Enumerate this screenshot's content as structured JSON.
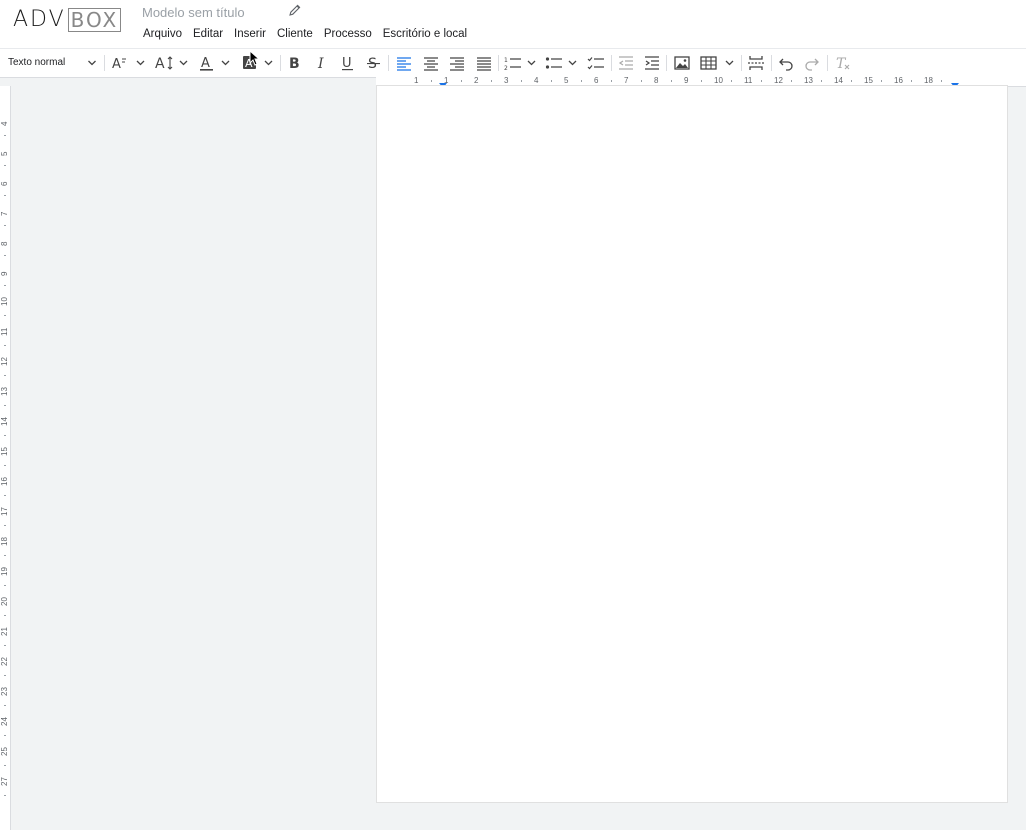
{
  "header": {
    "logo_part1": "ADV",
    "logo_part2": "BOX",
    "title_placeholder": "Modelo sem título",
    "edit_icon": "pencil-icon"
  },
  "menu": [
    {
      "label": "Arquivo"
    },
    {
      "label": "Editar"
    },
    {
      "label": "Inserir"
    },
    {
      "label": "Cliente"
    },
    {
      "label": "Processo"
    },
    {
      "label": "Escritório e local"
    }
  ],
  "toolbar": {
    "paragraph_style": "Texto normal",
    "icons": [
      "font-size-icon",
      "line-height-icon",
      "text-color-icon",
      "highlight-color-icon",
      "bold-icon",
      "italic-icon",
      "underline-icon",
      "strikethrough-icon",
      "align-left-icon",
      "align-center-icon",
      "align-right-icon",
      "align-justify-icon",
      "numbered-list-icon",
      "bulleted-list-icon",
      "checklist-icon",
      "decrease-indent-icon",
      "increase-indent-icon",
      "insert-image-icon",
      "insert-table-icon",
      "page-break-icon",
      "undo-icon",
      "redo-icon",
      "clear-formatting-icon"
    ],
    "active_color": "#1a73e8"
  },
  "ruler": {
    "horizontal_labels": [
      "1",
      "1",
      "2",
      "3",
      "4",
      "5",
      "6",
      "7",
      "8",
      "9",
      "10",
      "11",
      "12",
      "13",
      "14",
      "15",
      "16",
      "18"
    ],
    "vertical_labels": [
      "4",
      "5",
      "6",
      "7",
      "8",
      "9",
      "10",
      "11",
      "12",
      "13",
      "14",
      "15",
      "16",
      "17",
      "18",
      "19",
      "20",
      "21",
      "22",
      "23",
      "24",
      "25",
      "27"
    ]
  }
}
